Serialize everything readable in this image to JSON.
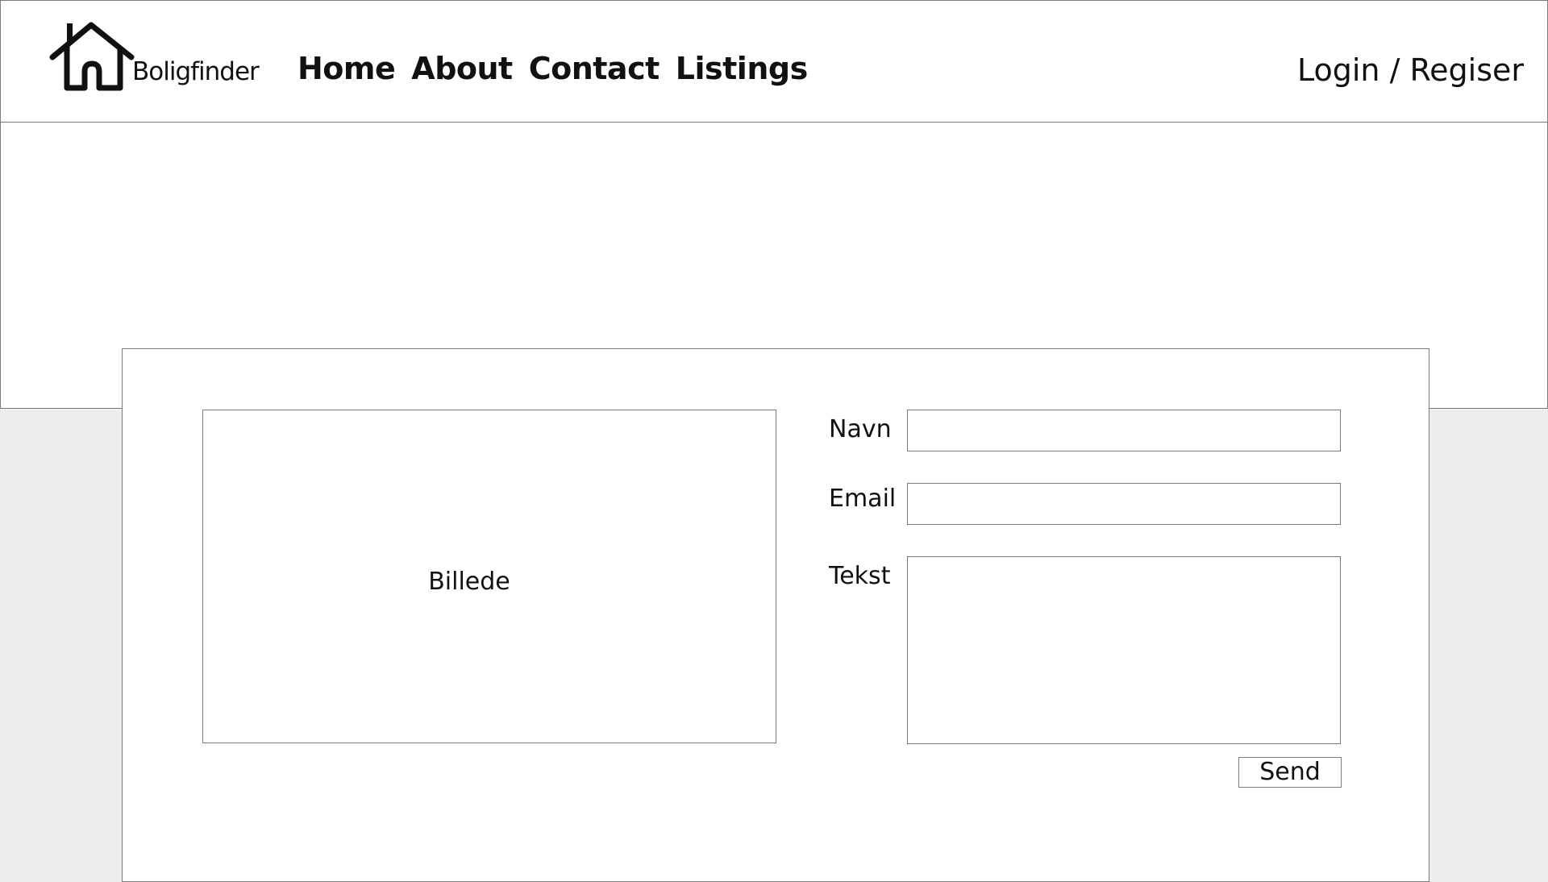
{
  "header": {
    "logo_text": "Boligfinder",
    "logo_icon": "house-icon",
    "nav": [
      {
        "label": "Home"
      },
      {
        "label": "About"
      },
      {
        "label": "Contact"
      },
      {
        "label": "Listings"
      }
    ],
    "login_label": "Login / Regiser"
  },
  "contact_form": {
    "image_placeholder": "Billede",
    "name_label": "Navn",
    "name_value": "",
    "email_label": "Email",
    "email_value": "",
    "text_label": "Tekst",
    "text_value": "",
    "send_label": "Send"
  }
}
